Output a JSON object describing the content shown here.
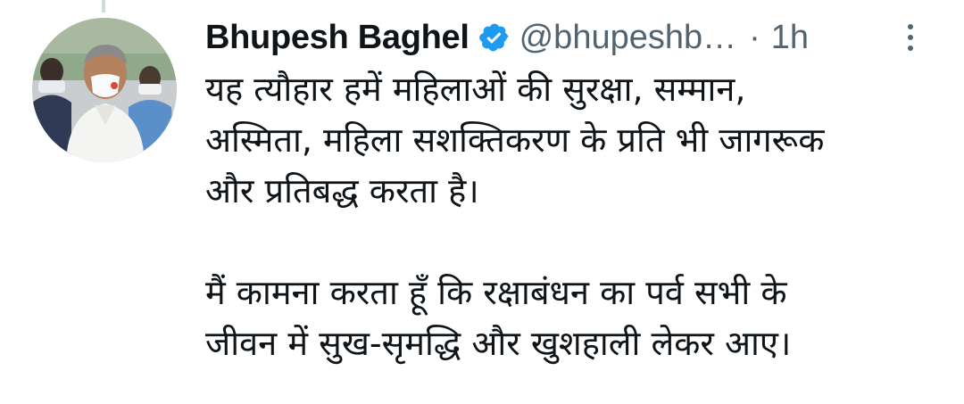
{
  "tweet": {
    "author_name": "Bhupesh Baghel",
    "handle": "@bhupeshb…",
    "separator": "·",
    "timestamp": "1h",
    "verified": true,
    "paragraphs": [
      "यह त्यौहार हमें महिलाओं की सुरक्षा, सम्मान,\nअस्मिता, महिला सशक्तिकरण के प्रति भी जागरूक\nऔर प्रतिबद्ध करता है।",
      "मैं कामना करता हूँ कि रक्षाबंधन का पर्व सभी के\nजीवन में सुख-सृमद्धि और खुशहाली लेकर आए।"
    ]
  },
  "icons": {
    "verified": "verified-badge-icon",
    "more": "more-vertical-icon",
    "avatar": "profile-photo"
  },
  "colors": {
    "verified_blue": "#1d9bf0",
    "secondary_text": "#536471",
    "primary_text": "#0f1419",
    "thread_line": "#cfd9de"
  }
}
